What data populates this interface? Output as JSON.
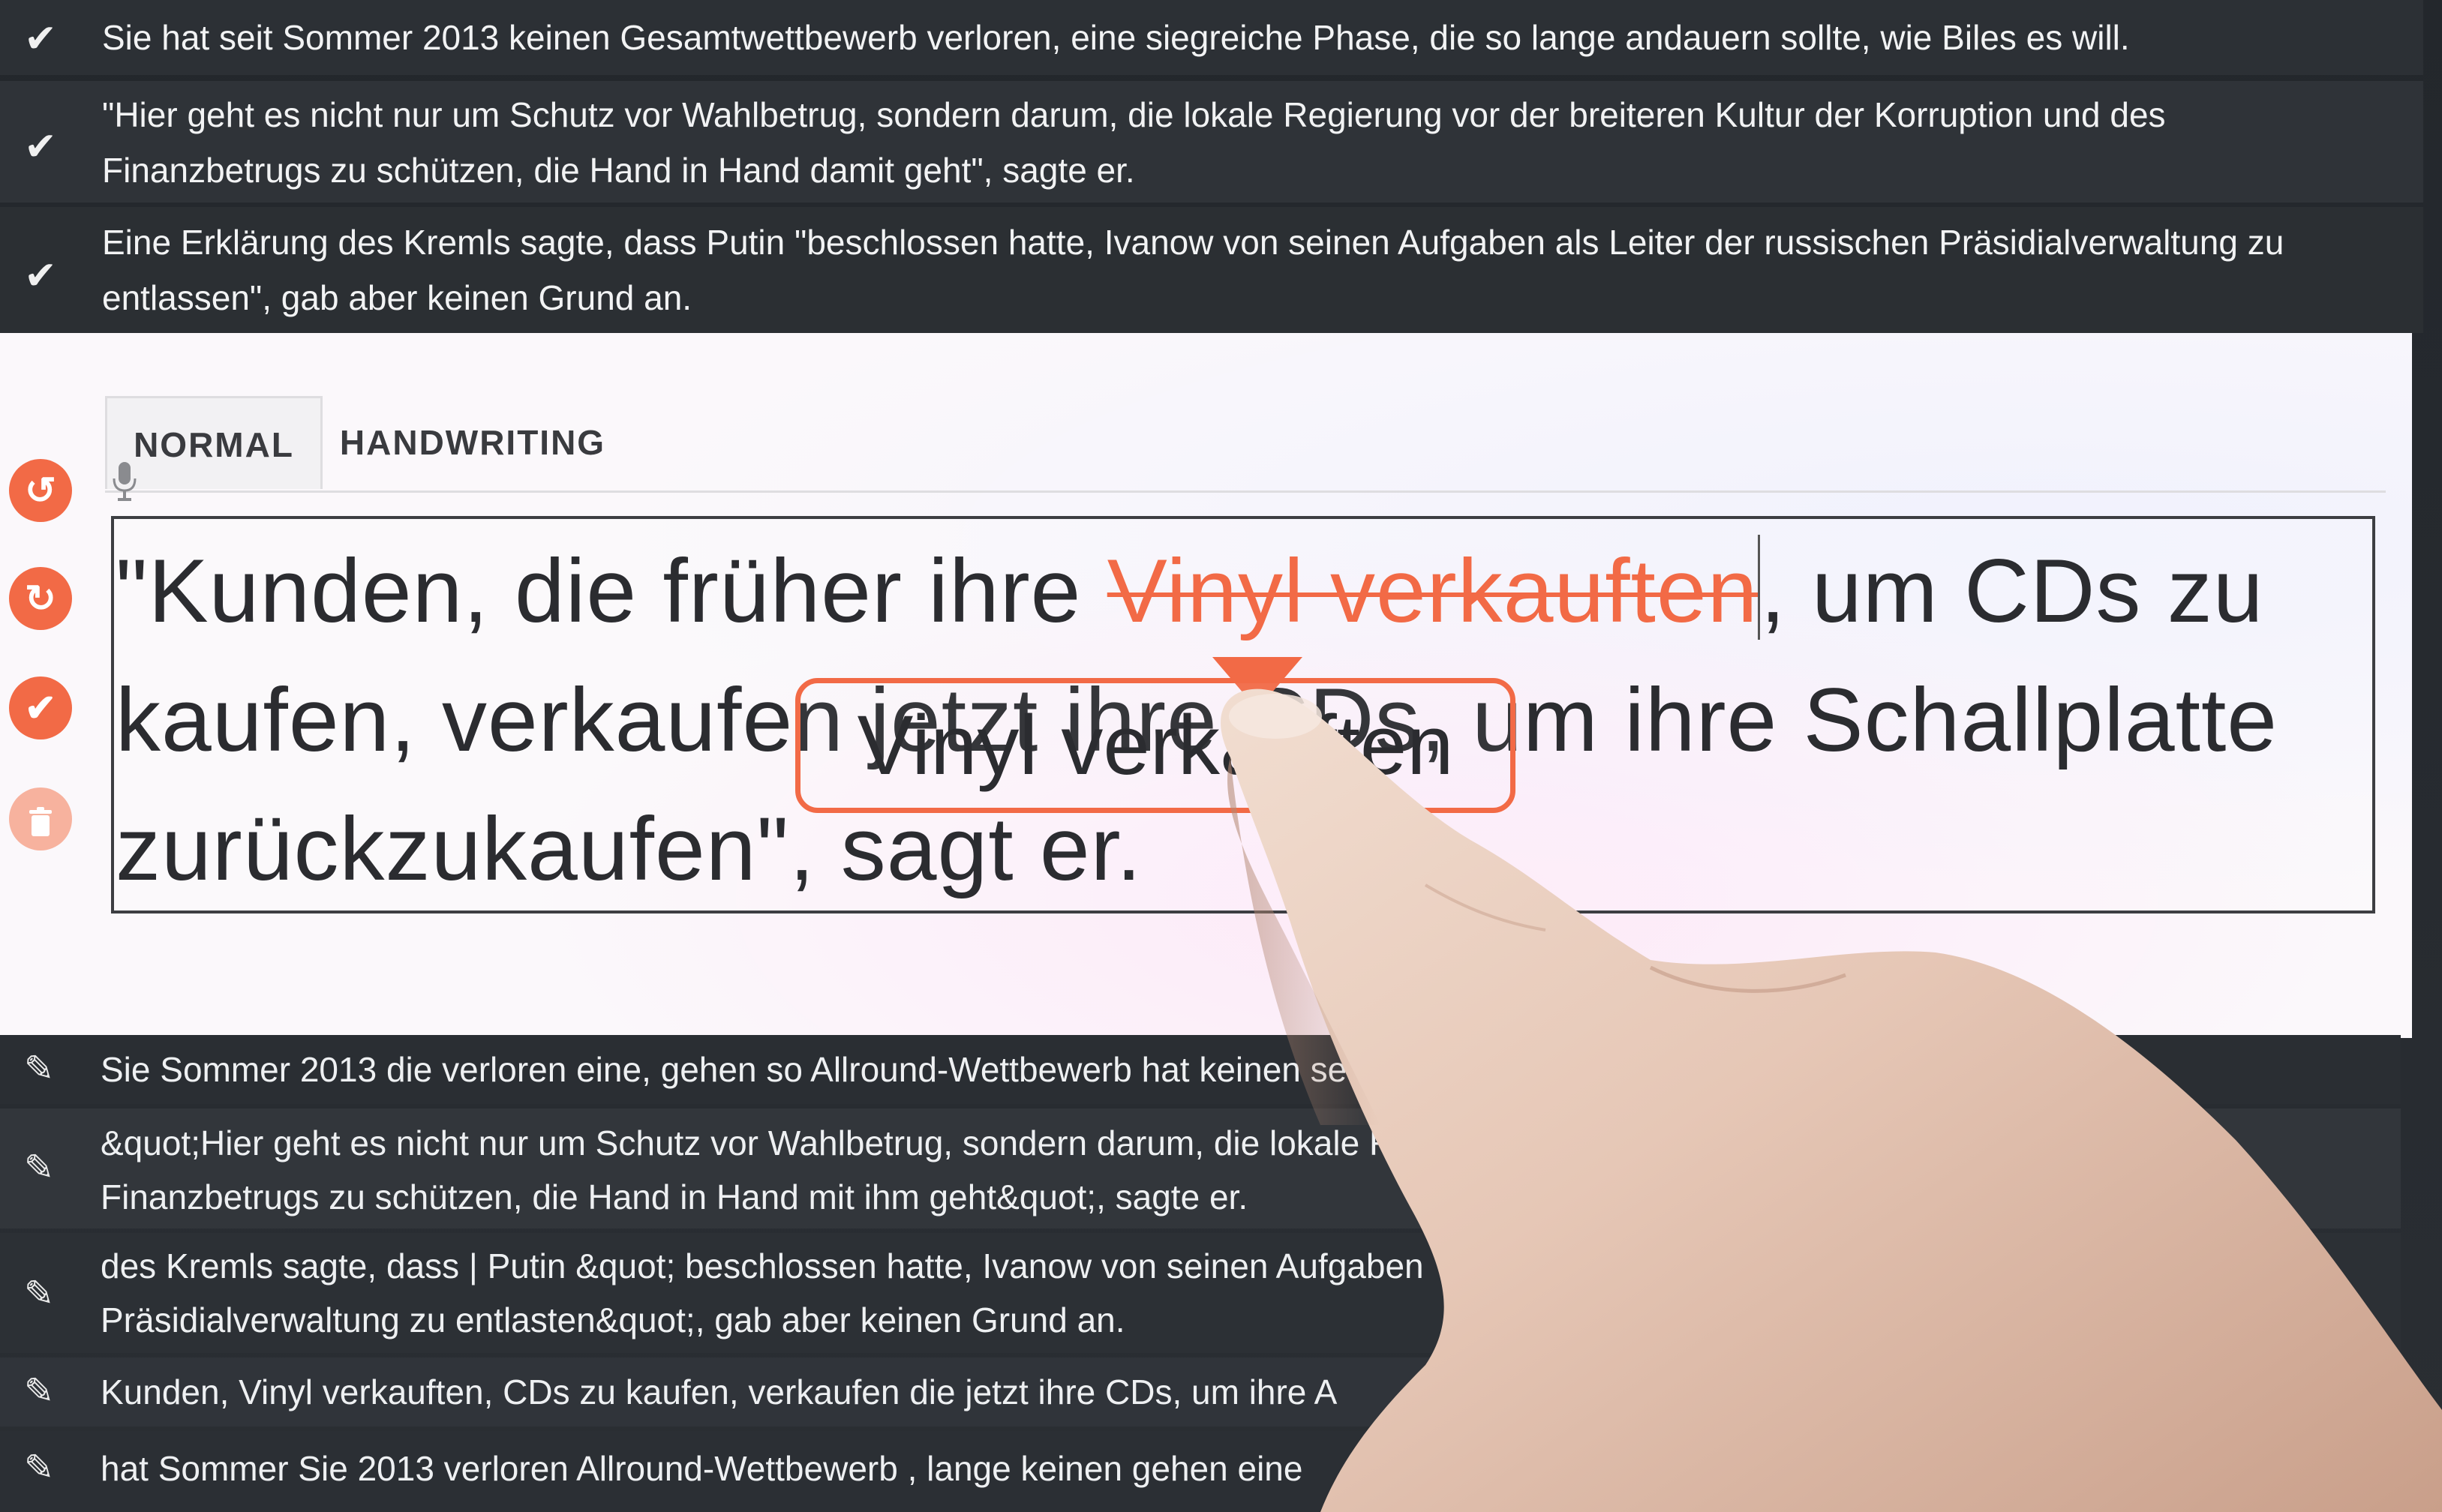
{
  "confirmed_rows": [
    {
      "icon": "checkmark-icon",
      "text": "Sie hat seit Sommer 2013 keinen Gesamtwettbewerb verloren, eine siegreiche Phase, die so lange andauern sollte, wie Biles es will."
    },
    {
      "icon": "checkmark-icon",
      "text": "\"Hier geht es nicht nur um Schutz vor Wahlbetrug, sondern darum, die lokale Regierung vor der breiteren Kultur der Korruption und des Finanzbetrugs zu schützen, die Hand in Hand damit geht\", sagte er."
    },
    {
      "icon": "checkmark-icon",
      "text": "Eine Erklärung des Kremls sagte, dass Putin \"beschlossen hatte, Ivanow von seinen Aufgaben als Leiter der russischen Präsidialverwaltung zu entlassen\", gab aber keinen Grund an."
    }
  ],
  "editor": {
    "tabs": [
      "NORMAL",
      "HANDWRITING"
    ],
    "active_tab": "NORMAL",
    "icons": {
      "mic": "microphone-icon",
      "undo": "undo-icon",
      "redo": "redo-icon",
      "confirm": "checkmark-icon",
      "delete": "trash-icon"
    },
    "text_before": "\"Kunden, die früher ihre ",
    "struck_text": "Vinyl verkauften",
    "text_after": ", um CDs zu kaufen, verkaufen jetzt ihre CDs, um ihre Schallplatte zurückzukaufen\", sagt er.",
    "popup_text": "Vinyl verkauften",
    "accent_color": "#f26a46"
  },
  "suggestion_rows": [
    {
      "icon": "pencil-icon",
      "text": "Sie Sommer 2013 die verloren eine, gehen so Allround-Wettbewerb hat keinen se"
    },
    {
      "icon": "pencil-icon",
      "text": "&quot;Hier geht es nicht nur um Schutz vor Wahlbetrug, sondern darum, die lokale R",
      "text2": "Finanzbetrugs zu schützen, die Hand in Hand mit ihm geht&quot;, sagte er."
    },
    {
      "icon": "pencil-icon",
      "text": "des Kremls sagte, dass | Putin &quot; beschlossen hatte, Ivanow von seinen Aufgaben",
      "text2": "Präsidialverwaltung zu entlasten&quot;, gab aber keinen Grund an."
    },
    {
      "icon": "pencil-icon",
      "text": "Kunden, Vinyl verkauften, CDs zu kaufen, verkaufen die jetzt ihre CDs, um ihre A"
    },
    {
      "icon": "pencil-icon",
      "text": "hat Sommer Sie 2013 verloren Allround-Wettbewerb , lange keinen gehen eine"
    }
  ]
}
